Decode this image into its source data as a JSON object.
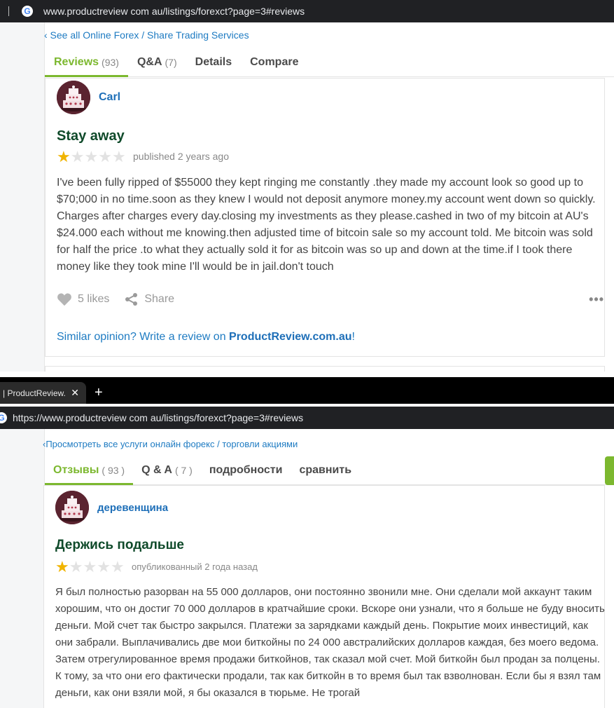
{
  "top": {
    "url": "www.productreview com au/listings/forexct?page=3#reviews",
    "breadcrumb": "‹ See all Online Forex / Share Trading Services",
    "tabs": [
      {
        "label": "Reviews",
        "count": "(93)"
      },
      {
        "label": "Q&A",
        "count": "(7)"
      },
      {
        "label": "Details",
        "count": ""
      },
      {
        "label": "Compare",
        "count": ""
      }
    ],
    "review": {
      "author": "Carl",
      "title": "Stay away",
      "rating": 1,
      "rating_max": 5,
      "published": "published 2 years ago",
      "body": "I've been fully ripped of $55000 they kept ringing me constantly .they made my account look so good up to $70;000 in no time.soon as they knew I would not deposit anymore money.my account went down so quickly. Charges after charges every day.closing my investments as they please.cashed in two of my bitcoin at AU's $24.000 each without me knowing.then adjusted time of bitcoin sale so my account told. Me bitcoin was sold for half the price .to what they actually sold it for as bitcoin was so up and down at the time.if I took there money like they took mine I'll would be in jail.don't touch",
      "likes": "5 likes",
      "share": "Share",
      "more": "•••",
      "similar_prefix": "Similar opinion? Write a review on ",
      "similar_link": "ProductReview.com.au",
      "similar_suffix": "!"
    }
  },
  "bottom": {
    "tab_title": "| ProductReview.",
    "tab_close": "✕",
    "new_tab": "+",
    "url": "https://www.productreview com au/listings/forexct?page=3#reviews",
    "breadcrumb": "‹Просмотреть все услуги онлайн форекс / торговли акциями",
    "tabs": [
      {
        "label": "Отзывы",
        "count": "( 93 )"
      },
      {
        "label": "Q & A",
        "count": "( 7 )"
      },
      {
        "label": "подробности",
        "count": ""
      },
      {
        "label": "сравнить",
        "count": ""
      }
    ],
    "review": {
      "author": "деревенщина",
      "title": "Держись подальше",
      "rating": 1,
      "rating_max": 5,
      "published": "опубликованный 2 года назад",
      "body": "Я был полностью разорван на 55 000 долларов, они постоянно звонили мне. Они сделали мой аккаунт таким хорошим, что он достиг 70 000 долларов в кратчайшие сроки. Вскоре они узнали, что я больше не буду вносить деньги. Мой счет так быстро закрылся. Платежи за зарядками каждый день. Покрытие моих инвестиций, как они забрали. Выплачивались две мои биткойны по 24 000 австралийских долларов каждая, без моего ведома. Затем отрегулированное время продажи биткойнов, так сказал мой счет. Мой биткойн был продан за полцены. К тому, за что они его фактически продали, так как биткойн в то время был так взволнован. Если бы я взял там деньги, как они взяли мой, я бы оказался в тюрьме. Не трогай"
    }
  },
  "colors": {
    "accent_green": "#7cb82f",
    "link_blue": "#1e7bc2",
    "title_green": "#0f4a2a",
    "star_gold": "#f0b400"
  }
}
